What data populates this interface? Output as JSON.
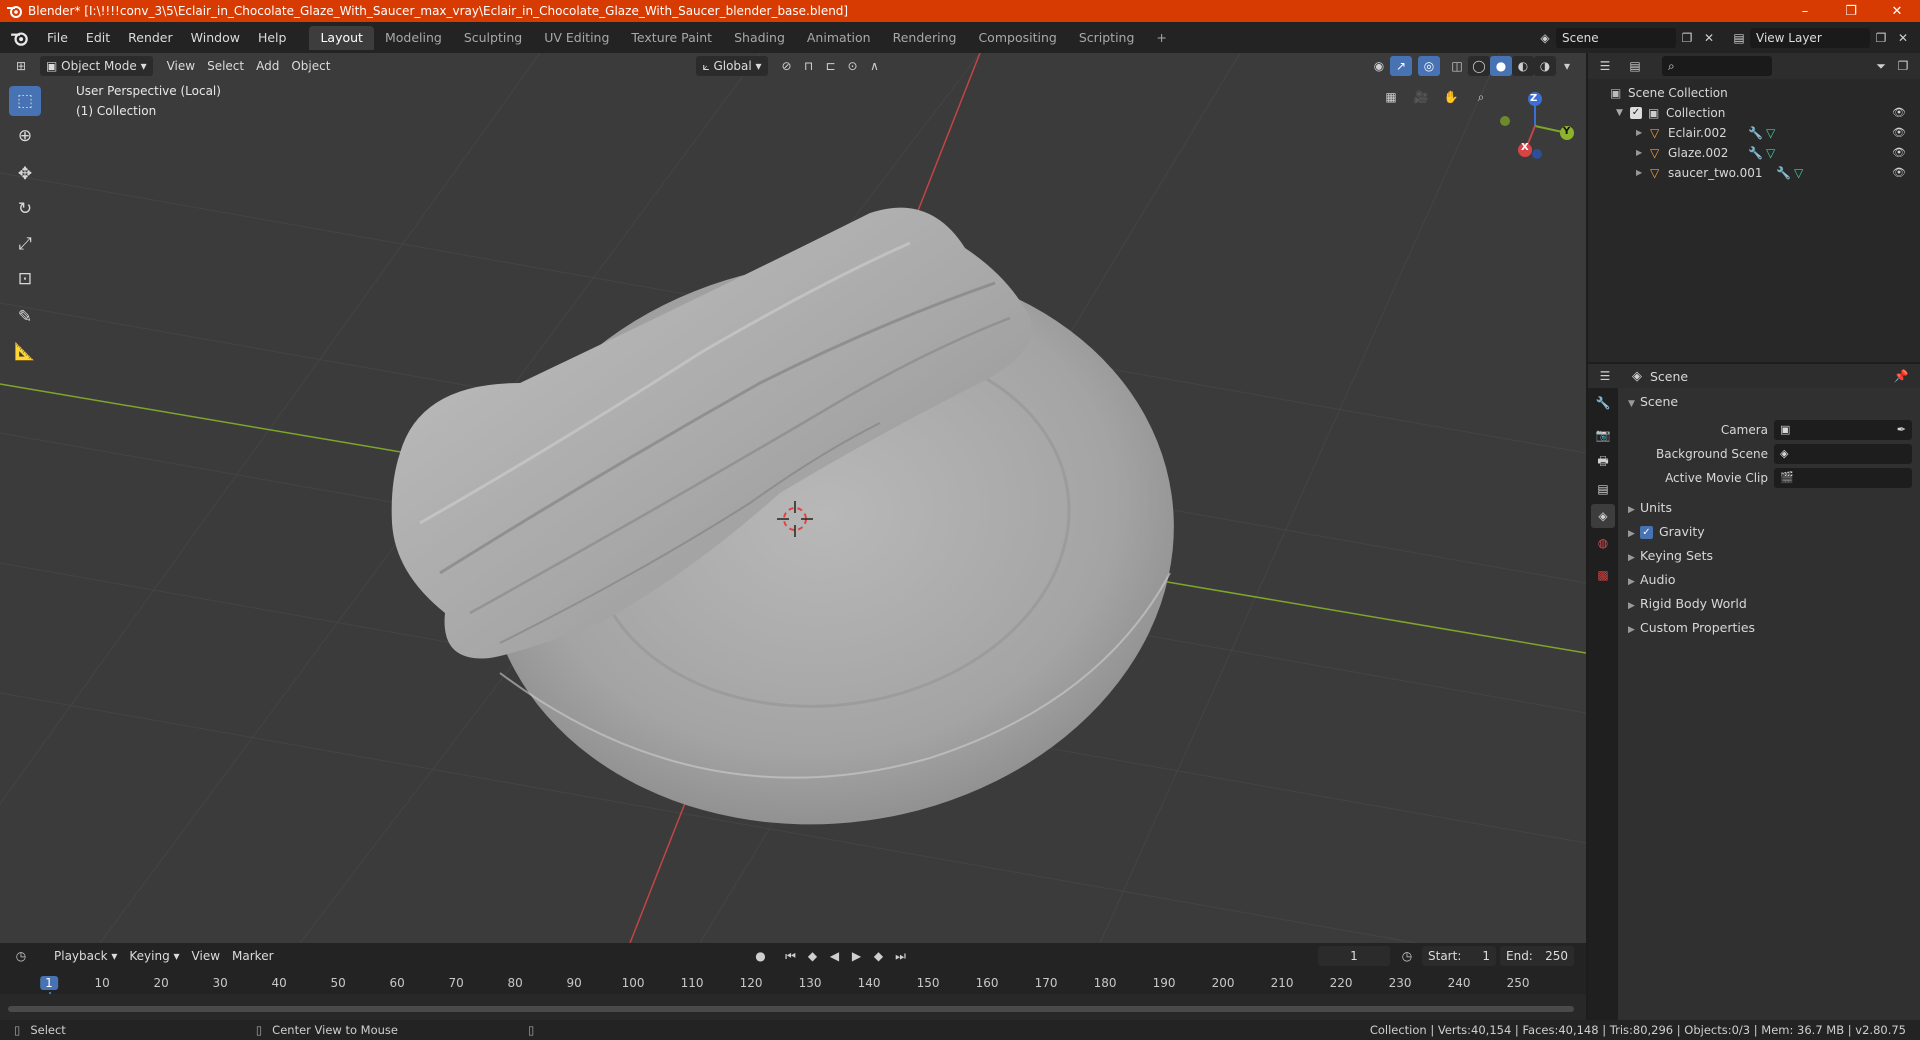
{
  "titlebar": {
    "title": "Blender* [I:\\!!!!conv_3\\5\\Eclair_in_Chocolate_Glaze_With_Saucer_max_vray\\Eclair_in_Chocolate_Glaze_With_Saucer_blender_base.blend]",
    "minimize": "–",
    "maximize": "❐",
    "close": "✕"
  },
  "menubar": {
    "menus": [
      "File",
      "Edit",
      "Render",
      "Window",
      "Help"
    ],
    "workspaces": [
      "Layout",
      "Modeling",
      "Sculpting",
      "UV Editing",
      "Texture Paint",
      "Shading",
      "Animation",
      "Rendering",
      "Compositing",
      "Scripting"
    ],
    "active_workspace": "Layout",
    "add_workspace": "+",
    "scene_name": "Scene",
    "view_layer": "View Layer"
  },
  "viewport": {
    "mode": "Object Mode",
    "menus": [
      "View",
      "Select",
      "Add",
      "Object"
    ],
    "transform_orientation": "Global",
    "perspective_label": "User Perspective (Local)",
    "collection_label": "(1) Collection",
    "gizmo_axes": {
      "x": "X",
      "y": "Y",
      "z": "Z"
    },
    "colors": {
      "background": "#3b3b3b",
      "x_axis": "#d14a4a",
      "y_axis": "#7fa52a",
      "grid": "#454545",
      "model": "#b5b5b5"
    }
  },
  "outliner": {
    "search_placeholder": "",
    "root": "Scene Collection",
    "collection": "Collection",
    "objects": [
      {
        "name": "Eclair.002"
      },
      {
        "name": "Glaze.002"
      },
      {
        "name": "saucer_two.001"
      }
    ]
  },
  "properties": {
    "context": "Scene",
    "panel_title": "Scene",
    "fields": [
      {
        "label": "Camera",
        "value": ""
      },
      {
        "label": "Background Scene",
        "value": ""
      },
      {
        "label": "Active Movie Clip",
        "value": ""
      }
    ],
    "sections": [
      "Units",
      "Gravity",
      "Keying Sets",
      "Audio",
      "Rigid Body World",
      "Custom Properties"
    ],
    "gravity_checked": true
  },
  "timeline": {
    "menus": [
      "Playback",
      "Keying",
      "View",
      "Marker"
    ],
    "current_frame": "1",
    "start_label": "Start:",
    "start": "1",
    "end_label": "End:",
    "end": "250",
    "ticks": [
      "1",
      "10",
      "20",
      "30",
      "40",
      "50",
      "60",
      "70",
      "80",
      "90",
      "100",
      "110",
      "120",
      "130",
      "140",
      "150",
      "160",
      "170",
      "180",
      "190",
      "200",
      "210",
      "220",
      "230",
      "240",
      "250"
    ]
  },
  "statusbar": {
    "left_action": "Select",
    "middle_action": "Center View to Mouse",
    "stats": "Collection | Verts:40,154 | Faces:40,148 | Tris:80,296 | Objects:0/3 | Mem: 36.7 MB | v2.80.75"
  }
}
